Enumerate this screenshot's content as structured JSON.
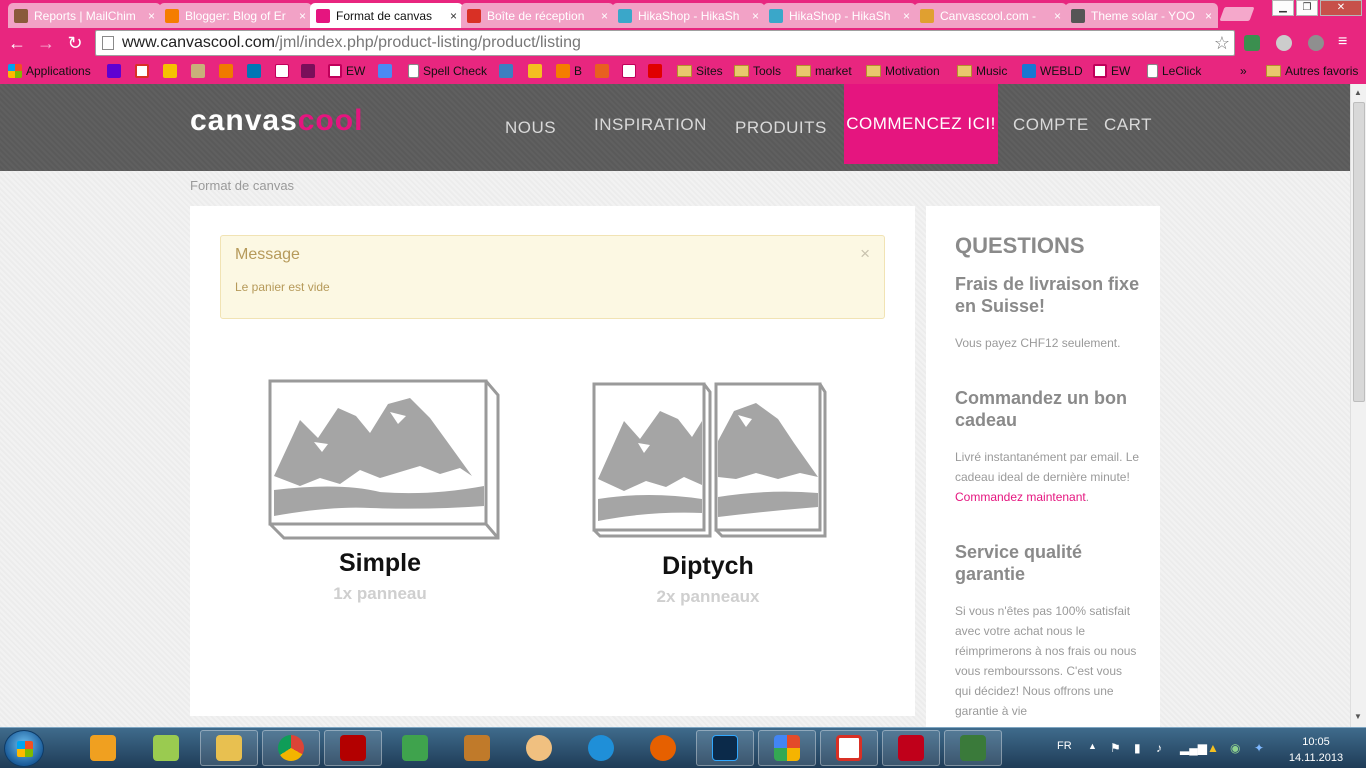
{
  "browser": {
    "tabs": [
      {
        "label": "Reports | MailChim",
        "favicon_color": "#8a5a3a"
      },
      {
        "label": "Blogger: Blog of Er",
        "favicon_color": "#f57d00"
      },
      {
        "label": "Format de canvas",
        "favicon_color": "#e5157f",
        "active": true
      },
      {
        "label": "Boîte de réception",
        "favicon_color": "#d93025"
      },
      {
        "label": "HikaShop - HikaSh",
        "favicon_color": "#3aa7c9"
      },
      {
        "label": "HikaShop - HikaSh",
        "favicon_color": "#3aa7c9"
      },
      {
        "label": "Canvascool.com -",
        "favicon_color": "#e0a030"
      },
      {
        "label": "Theme solar - YOO",
        "favicon_color": "#555555"
      }
    ],
    "tab_close_glyph": "×",
    "url_host": "www.canvascool.com",
    "url_path": "/jml/index.php/product-listing/product/listing",
    "bookmarks": [
      {
        "label": "Applications",
        "icon": "apps-grid-icon"
      },
      {
        "label": "",
        "icon": "yahoo-icon"
      },
      {
        "label": "",
        "icon": "gmail-icon"
      },
      {
        "label": "",
        "icon": "keep-icon"
      },
      {
        "label": "",
        "icon": "figure-icon"
      },
      {
        "label": "",
        "icon": "orange-icon"
      },
      {
        "label": "",
        "icon": "linkedin-icon"
      },
      {
        "label": "",
        "icon": "hi-icon"
      },
      {
        "label": "",
        "icon": "c-icon"
      },
      {
        "label": "EW",
        "icon": "e-icon"
      },
      {
        "label": "",
        "icon": "translate-icon"
      },
      {
        "label": "Spell Check",
        "icon": "page-icon"
      },
      {
        "label": "",
        "icon": "check-icon"
      },
      {
        "label": "",
        "icon": "sun-icon"
      },
      {
        "label": "B",
        "icon": "blogger-icon"
      },
      {
        "label": "",
        "icon": "chart-icon"
      },
      {
        "label": "",
        "icon": "hi-icon"
      },
      {
        "label": "",
        "icon": "youtube-icon"
      },
      {
        "label": "Sites",
        "icon": "folder-icon"
      },
      {
        "label": "Tools",
        "icon": "folder-icon"
      },
      {
        "label": "market",
        "icon": "folder-icon"
      },
      {
        "label": "Motivation",
        "icon": "folder-icon"
      },
      {
        "label": "Music",
        "icon": "folder-icon"
      },
      {
        "label": "WEBLD",
        "icon": "webld-icon"
      },
      {
        "label": "EW",
        "icon": "e-icon"
      },
      {
        "label": "LeClick",
        "icon": "page-icon"
      }
    ],
    "more_glyph": "»",
    "other_bookmarks": "Autres favoris"
  },
  "site": {
    "logo_part1": "canvas",
    "logo_part2": "cool",
    "brand_color": "#e5157f",
    "menu": [
      "NOUS",
      "INSPIRATION",
      "PRODUITS",
      "COMMENCEZ ICI!",
      "COMPTE",
      "CART"
    ],
    "breadcrumb": "Format de canvas",
    "alert": {
      "title": "Message",
      "text": "Le panier est vide",
      "close": "×"
    },
    "products": [
      {
        "name": "Simple",
        "sub": "1x panneau",
        "panels": 1
      },
      {
        "name": "Diptych",
        "sub": "2x panneaux",
        "panels": 2
      }
    ],
    "sidebar": {
      "title": "QUESTIONS",
      "s1_title": "Frais de livraison fixe en Suisse!",
      "s1_text": "Vous payez CHF12 seulement.",
      "s2_title": "Commandez un bon cadeau",
      "s2_text": "Livré instantanément par email. Le cadeau ideal de dernière minute!",
      "s2_link": "Commandez maintenant",
      "s2_link_suffix": ".",
      "s3_title": "Service qualité garantie",
      "s3_text": "Si vous n'êtes pas 100% satisfait avec votre achat nous le réimprimerons à nos frais ou nous vous rembourssons. C'est vous qui décidez! Nous offrons une garantie à vie"
    }
  },
  "taskbar": {
    "lang": "FR",
    "time": "10:05",
    "date": "14.11.2013",
    "apps": [
      {
        "icon": "media-player-icon",
        "color": "#f0a020"
      },
      {
        "icon": "photos-icon",
        "color": "#9acb50"
      },
      {
        "icon": "explorer-icon",
        "color": "#e8c050"
      },
      {
        "icon": "chrome-icon",
        "color": "#db4437"
      },
      {
        "icon": "filezilla-icon",
        "color": "#b30000"
      },
      {
        "icon": "sync-icon",
        "color": "#3fa34d"
      },
      {
        "icon": "media-icon",
        "color": "#c07a2a"
      },
      {
        "icon": "worker-icon",
        "color": "#f0c080"
      },
      {
        "icon": "ie-icon",
        "color": "#1f8fd8"
      },
      {
        "icon": "firefox-icon",
        "color": "#e66000"
      },
      {
        "icon": "photoshop-icon",
        "color": "#0b2a4a"
      },
      {
        "icon": "grid-icon",
        "color": "#e34b2a"
      },
      {
        "icon": "gmail-icon",
        "color": "#d93025"
      },
      {
        "icon": "acrobat-icon",
        "color": "#c0001a"
      },
      {
        "icon": "terminal-icon",
        "color": "#3a7a3a"
      }
    ]
  }
}
